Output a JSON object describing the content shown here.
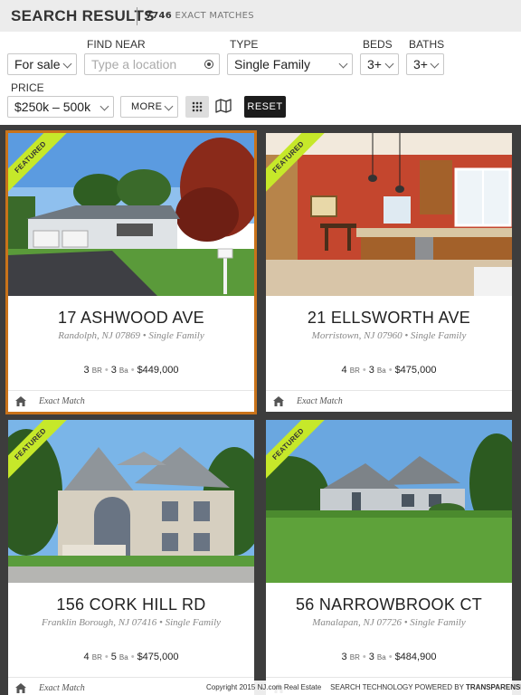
{
  "header": {
    "title": "SEARCH RESULTS",
    "count": "7746",
    "count_label": "EXACT MATCHES"
  },
  "filters": {
    "listing_type": "For sale",
    "find_near_label": "FIND NEAR",
    "find_near_placeholder": "Type a location",
    "type_label": "TYPE",
    "type_value": "Single Family",
    "beds_label": "BEDS",
    "beds_value": "3+",
    "baths_label": "BATHS",
    "baths_value": "3+",
    "price_label": "PRICE",
    "price_value": "$250k – 500k",
    "more_label": "MORE",
    "reset_label": "RESET",
    "active_view": "grid"
  },
  "listings": [
    {
      "ribbon": "FEATURED",
      "address": "17 ASHWOOD AVE",
      "location": "Randolph, NJ 07869 • Single Family",
      "beds": "3",
      "baths": "3",
      "price": "$449,000",
      "match": "Exact Match",
      "selected": true
    },
    {
      "ribbon": "FEATURED",
      "address": "21 ELLSWORTH AVE",
      "location": "Morristown, NJ 07960 • Single Family",
      "beds": "4",
      "baths": "3",
      "price": "$475,000",
      "match": "Exact Match"
    },
    {
      "ribbon": "FEATURED",
      "address": "156 CORK HILL RD",
      "location": "Franklin Borough, NJ 07416 • Single Family",
      "beds": "4",
      "baths": "5",
      "price": "$475,000",
      "match": "Exact Match"
    },
    {
      "ribbon": "FEATURED",
      "address": "56 NARROWBROOK CT",
      "location": "Manalapan, NJ 07726 • Single Family",
      "beds": "3",
      "baths": "3",
      "price": "$484,900",
      "match": ""
    }
  ],
  "units": {
    "beds": "BR",
    "baths": "Ba"
  },
  "colors": {
    "ribbon": "#c6e82a",
    "selected_border": "#c9731a",
    "reset_bg": "#1c1c1c"
  },
  "footer": {
    "copyright": "Copyright 2015 NJ.com Real Estate",
    "powered": "SEARCH TECHNOLOGY POWERED BY",
    "brand": "TRANSPARENSEE"
  }
}
